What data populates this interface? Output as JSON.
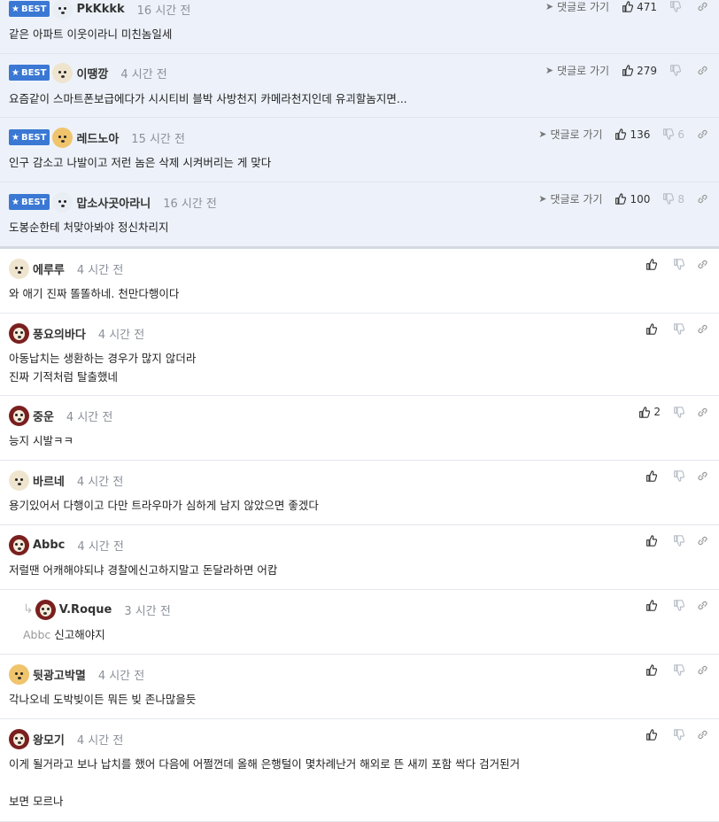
{
  "best_label": "BEST",
  "goto_label": "댓글로 가기",
  "best_comments": [
    {
      "author": "PkKkkk",
      "time": "16 시간 전",
      "text": "같은 아파트 이웃이라니 미친놈일세",
      "likes": "471",
      "dislikes": "",
      "avatar": "white"
    },
    {
      "author": "이땡깡",
      "time": "4 시간 전",
      "text": "요즘같이 스마트폰보급에다가 시시티비 블박 사방천지 카메라천지인데 유괴할놈지면...",
      "likes": "279",
      "dislikes": "",
      "avatar": "cream"
    },
    {
      "author": "레드노아",
      "time": "15 시간 전",
      "text": "인구 감소고 나발이고 저런 놈은 삭제 시켜버리는 게 맞다",
      "likes": "136",
      "dislikes": "6",
      "avatar": "fox"
    },
    {
      "author": "맙소사곳아라니",
      "time": "16 시간 전",
      "text": "도봉순한테 처맞아봐야 정신차리지",
      "likes": "100",
      "dislikes": "8",
      "avatar": "white"
    }
  ],
  "comments": [
    {
      "author": "에루루",
      "time": "4 시간 전",
      "text": "와 애기 진짜 똘똘하네. 천만다행이다",
      "likes": "",
      "avatar": "cream"
    },
    {
      "author": "풍요의바다",
      "time": "4 시간 전",
      "text": "아동납치는 생환하는 경우가 많지 않더라\n진짜 기적처럼 탈출했네",
      "likes": "",
      "avatar": "dark"
    },
    {
      "author": "중운",
      "time": "4 시간 전",
      "text": "능지 시발ㅋㅋ",
      "likes": "2",
      "avatar": "dark"
    },
    {
      "author": "바르네",
      "time": "4 시간 전",
      "text": "용기있어서 다행이고 다만 트라우마가 심하게 남지 않았으면 좋겠다",
      "likes": "",
      "avatar": "cream"
    },
    {
      "author": "Abbc",
      "time": "4 시간 전",
      "text": "저럴땐 어캐해야되냐 경찰에신고하지말고 돈달라하면 어캄",
      "likes": "",
      "avatar": "dark"
    },
    {
      "author": "V.Roque",
      "time": "3 시간 전",
      "text": "신고해야지",
      "mention": "Abbc",
      "likes": "",
      "avatar": "dark",
      "reply": true
    },
    {
      "author": "뒷광고박멸",
      "time": "4 시간 전",
      "text": "각나오네 도박빚이든 뭐든 빚 존나많을듯",
      "likes": "",
      "avatar": "fox"
    },
    {
      "author": "왕모기",
      "time": "4 시간 전",
      "text": "이게 될거라고 보나 납치를 했어 다음에 어쩔껀데 올해 은행털이 몇차례난거 해외로 뜬 새끼 포함 싹다 검거된거\n\n보면 모르나",
      "likes": "",
      "avatar": "dark"
    }
  ],
  "icons": [
    "star-icon",
    "thumbs-up-icon",
    "thumbs-down-icon",
    "link-icon",
    "send-arrow-icon",
    "reply-arrow-icon"
  ]
}
